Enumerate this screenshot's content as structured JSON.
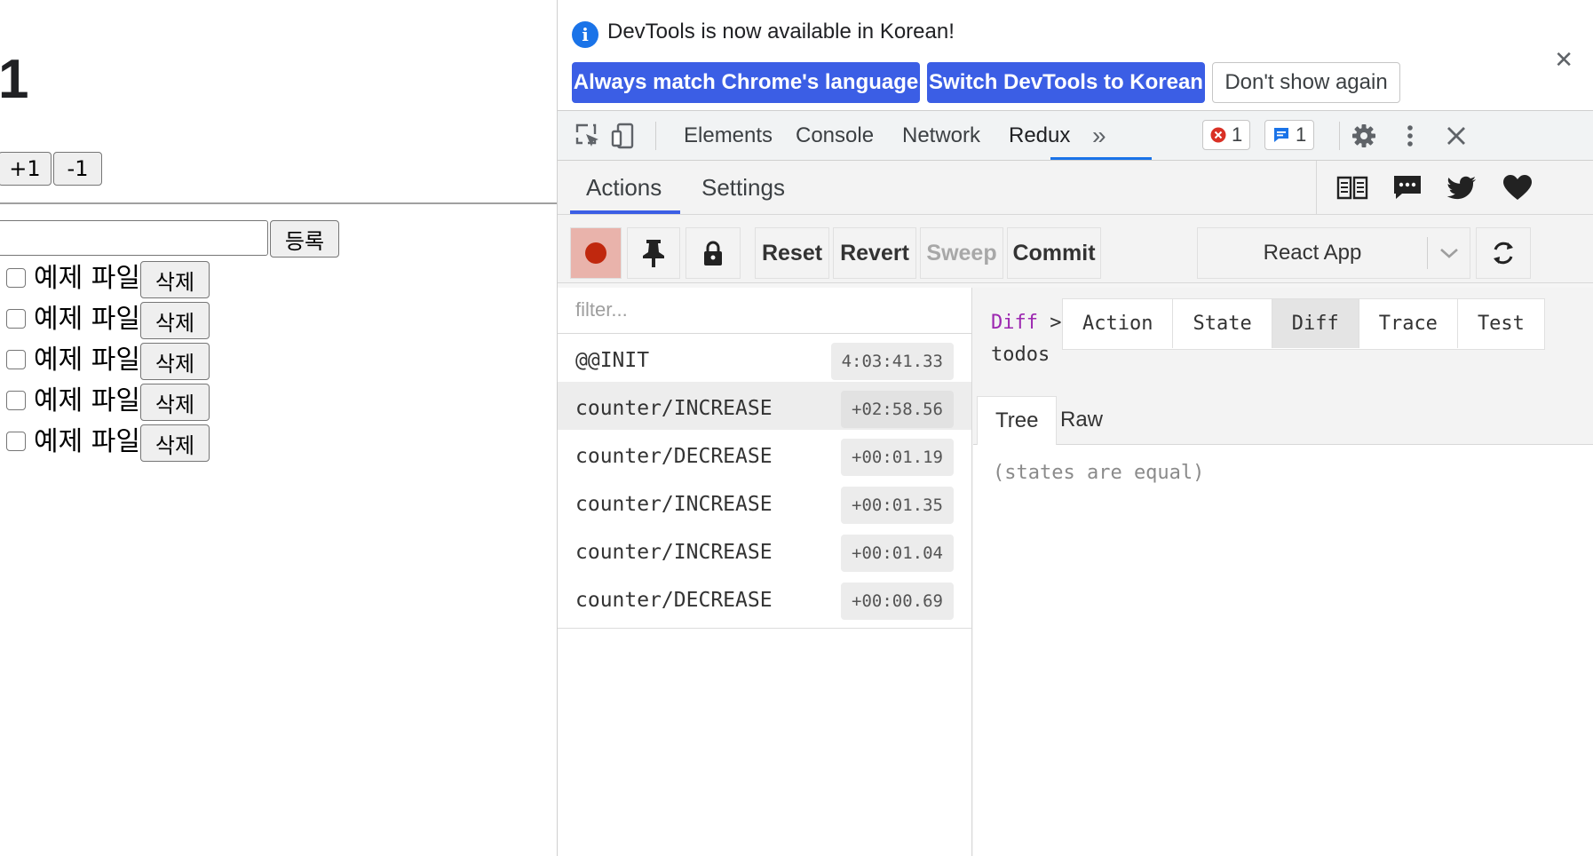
{
  "app": {
    "counter_value": "1",
    "increment_label": "+1",
    "decrement_label": "-1",
    "todo_input_value": "",
    "register_label": "등록",
    "todos": [
      {
        "text": "예제 파일",
        "delete_label": "삭제",
        "done": false
      },
      {
        "text": "예제 파일",
        "delete_label": "삭제",
        "done": false
      },
      {
        "text": "예제 파일",
        "delete_label": "삭제",
        "done": false
      },
      {
        "text": "예제 파일",
        "delete_label": "삭제",
        "done": false
      },
      {
        "text": "예제 파일",
        "delete_label": "삭제",
        "done": false
      }
    ]
  },
  "devtools": {
    "infobar": {
      "message": "DevTools is now available in Korean!",
      "match_language": "Always match Chrome's language",
      "switch_language": "Switch DevTools to Korean",
      "dont_show": "Don't show again"
    },
    "tabs": [
      "Elements",
      "Console",
      "Network",
      "Redux"
    ],
    "active_tab": "Redux",
    "error_count": "1",
    "message_count": "1"
  },
  "redux": {
    "tabs": {
      "actions": "Actions",
      "settings": "Settings"
    },
    "toolbar": {
      "reset": "Reset",
      "revert": "Revert",
      "sweep": "Sweep",
      "commit": "Commit",
      "instance": "React App"
    },
    "filter_placeholder": "filter...",
    "actions": [
      {
        "name": "@@INIT",
        "time": "4:03:41.33"
      },
      {
        "name": "counter/INCREASE",
        "time": "+02:58.56"
      },
      {
        "name": "counter/DECREASE",
        "time": "+00:01.19"
      },
      {
        "name": "counter/INCREASE",
        "time": "+00:01.35"
      },
      {
        "name": "counter/INCREASE",
        "time": "+00:01.04"
      },
      {
        "name": "counter/DECREASE",
        "time": "+00:00.69"
      }
    ],
    "monitor": {
      "breadcrumb_link": "Diff",
      "breadcrumb_sep": ">",
      "breadcrumb_current": "todos",
      "tabs": [
        "Action",
        "State",
        "Diff",
        "Trace",
        "Test"
      ],
      "active_tab": "Diff",
      "subtabs": [
        "Tree",
        "Raw"
      ],
      "active_subtab": "Tree",
      "diff_message": "(states are equal)"
    },
    "colors": {
      "accent": "#3b5ee5",
      "record": "#c0280e",
      "breadcrumb": "#9c27b0"
    }
  }
}
